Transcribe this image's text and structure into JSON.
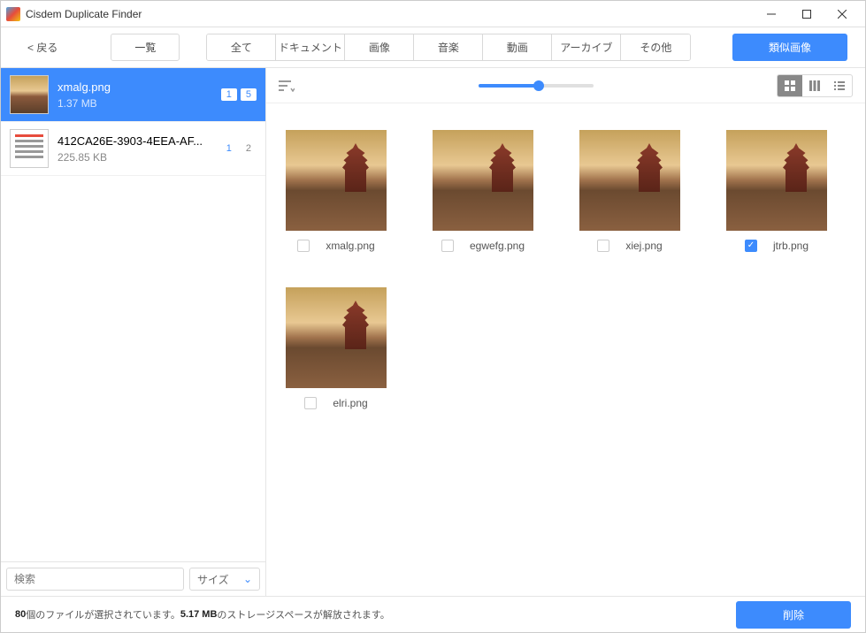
{
  "window": {
    "title": "Cisdem Duplicate Finder"
  },
  "toolbar": {
    "back": "< 戻る",
    "list_view": "一覧",
    "tabs": {
      "all": "全て",
      "document": "ドキュメント",
      "image": "画像",
      "music": "音楽",
      "video": "動画",
      "archive": "アーカイブ",
      "other": "その他"
    },
    "similar": "類似画像"
  },
  "sidebar": {
    "items": [
      {
        "name": "xmalg.png",
        "size": "1.37 MB",
        "badge1": "1",
        "badge2": "5"
      },
      {
        "name": "412CA26E-3903-4EEA-AF...",
        "size": "225.85 KB",
        "badge1": "1",
        "badge2": "2"
      }
    ],
    "search_placeholder": "検索",
    "size_label": "サイズ"
  },
  "grid": {
    "items": [
      {
        "name": "xmalg.png",
        "checked": false
      },
      {
        "name": "egwefg.png",
        "checked": false
      },
      {
        "name": "xiej.png",
        "checked": false
      },
      {
        "name": "jtrb.png",
        "checked": true
      },
      {
        "name": "elri.png",
        "checked": false
      }
    ]
  },
  "status": {
    "count": "80",
    "text1": " 個のファイルが選択されています。 ",
    "size": "5.17 MB",
    "text2": " のストレージスペースが解放されます。",
    "delete": "削除"
  }
}
